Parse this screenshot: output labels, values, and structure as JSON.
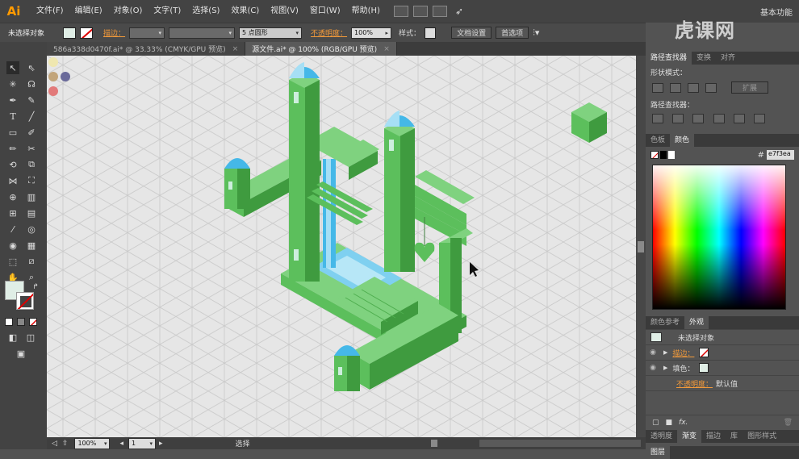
{
  "app": {
    "logo": "Ai"
  },
  "menu": [
    "文件(F)",
    "编辑(E)",
    "对象(O)",
    "文字(T)",
    "选择(S)",
    "效果(C)",
    "视图(V)",
    "窗口(W)",
    "帮助(H)"
  ],
  "workspace": "基本功能",
  "brand_watermark": "虎课网",
  "control_bar": {
    "selection": "未选择对象",
    "stroke_label": "描边：",
    "brush": "5 点圆形",
    "opacity_label": "不透明度：",
    "opacity_value": "100%",
    "style_label": "样式：",
    "doc_setup": "文档设置",
    "prefs": "首选项"
  },
  "tabs": [
    {
      "label": "586a338d0470f.ai* @ 33.33% (CMYK/GPU 预览)",
      "active": false
    },
    {
      "label": "源文件.ai* @ 100% (RGB/GPU 预览)",
      "active": true
    }
  ],
  "status": {
    "zoom": "100%",
    "artboard": "1",
    "mode": "选择"
  },
  "pathfinder": {
    "tabs": [
      "路径查找器",
      "变换",
      "对齐"
    ],
    "shape_modes": "形状模式：",
    "expand": "扩展",
    "pathfinders": "路径查找器："
  },
  "color_panel": {
    "tabs": [
      "色板",
      "颜色"
    ],
    "hex": "e7f3ea"
  },
  "appearance": {
    "tabs": [
      "颜色参考",
      "外观"
    ],
    "title": "未选择对象",
    "stroke": "描边：",
    "fill": "填色：",
    "opacity": "不透明度：",
    "opacity_value": "默认值",
    "fx": "fx."
  },
  "bottom_tabs": [
    "透明度",
    "渐变",
    "描边",
    "库",
    "图形样式"
  ],
  "layers_tab": "图层",
  "colors": {
    "fill": "#e0eee6",
    "green": "#5cbf5c",
    "green_dark": "#3f9b3f",
    "green_light": "#7fd27f",
    "blue": "#45b8e8",
    "accent": "#f39a3a"
  }
}
